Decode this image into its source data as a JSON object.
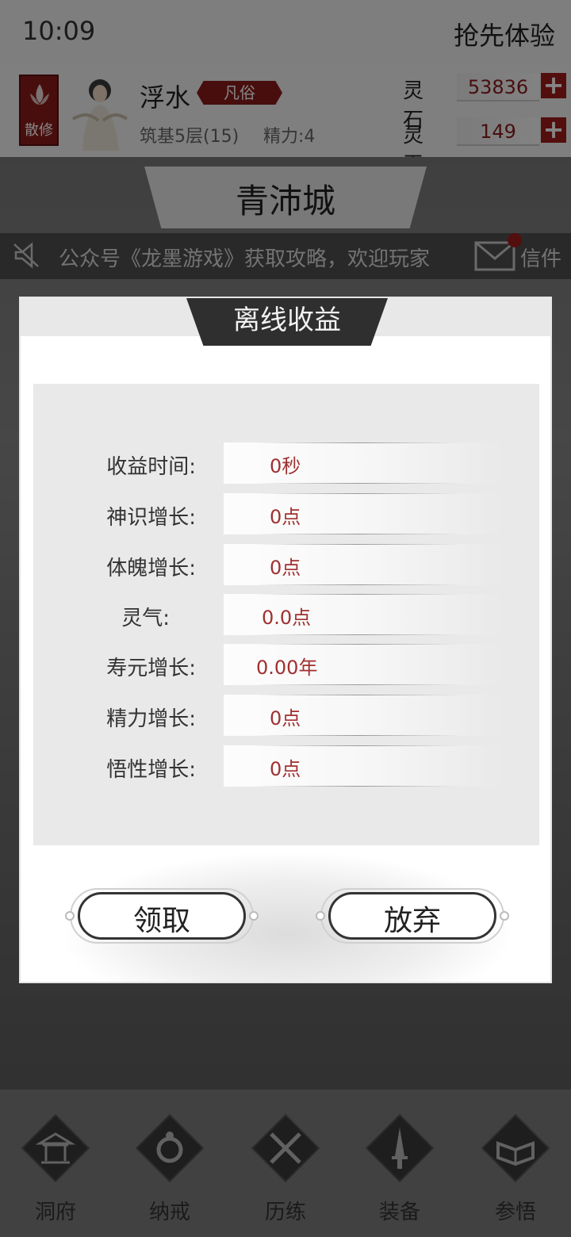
{
  "status_bar": {
    "time": "10:09",
    "early_access": "抢先体验"
  },
  "player": {
    "rank": "散修",
    "name": "浮水",
    "class_badge": "凡俗",
    "realm": "筑基5层(15)",
    "energy": "精力:4"
  },
  "resources": [
    {
      "label": "灵石",
      "value": "53836",
      "icon": "plus-icon"
    },
    {
      "label": "灵玉",
      "value": "149",
      "icon": "plus-icon"
    }
  ],
  "location": {
    "city": "青沛城"
  },
  "notice": {
    "text": "公众号《龙墨游戏》获取攻略，欢迎玩家",
    "mail_label": "信件"
  },
  "dialog": {
    "title": "离线收益",
    "stats": [
      {
        "label": "收益时间:",
        "value": "0秒"
      },
      {
        "label": "神识增长:",
        "value": "0点"
      },
      {
        "label": "体魄增长:",
        "value": "0点"
      },
      {
        "label": "灵气:",
        "value": "0.0点"
      },
      {
        "label": "寿元增长:",
        "value": "0.00年"
      },
      {
        "label": "精力增长:",
        "value": "0点"
      },
      {
        "label": "悟性增长:",
        "value": "0点"
      }
    ],
    "claim_label": "领取",
    "discard_label": "放弃"
  },
  "nav": [
    {
      "label": "洞府",
      "icon": "pavilion-icon"
    },
    {
      "label": "纳戒",
      "icon": "ring-icon"
    },
    {
      "label": "历练",
      "icon": "crossed-swords-icon"
    },
    {
      "label": "装备",
      "icon": "dagger-icon"
    },
    {
      "label": "参悟",
      "icon": "book-icon"
    }
  ],
  "colors": {
    "accent_red": "#8a1c1c",
    "value_red": "#a03030",
    "dialog_tab": "#2f2f2f"
  }
}
